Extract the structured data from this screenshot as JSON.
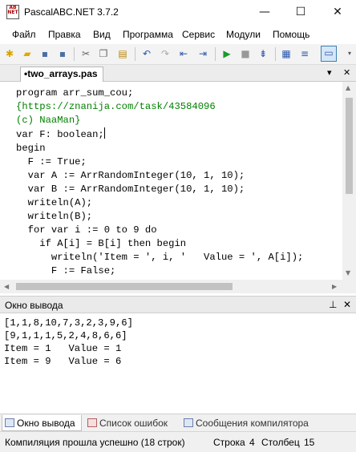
{
  "window": {
    "title": "PascalABC.NET 3.7.2",
    "minimize": "—",
    "maximize": "☐",
    "close": "✕"
  },
  "menu": [
    "Файл",
    "Правка",
    "Вид",
    "Программа",
    "Сервис",
    "Модули",
    "Помощь"
  ],
  "editor_tab": {
    "label": "•two_arrays.pas",
    "dropdown": "▾",
    "close": "✕"
  },
  "code": [
    "program arr_sum_cou;",
    "{https://znanija.com/task/43584096",
    "(c) NaaMan}",
    "var F: boolean;",
    "begin",
    "  F := True;",
    "  var A := ArrRandomInteger(10, 1, 10);",
    "  var B := ArrRandomInteger(10, 1, 10);",
    "  writeln(A);",
    "  writeln(B);",
    "  for var i := 0 to 9 do",
    "    if A[i] = B[i] then begin",
    "      writeln('Item = ', i, '   Value = ', A[i]);",
    "      F := False;"
  ],
  "output_panel": {
    "title": "Окно вывода",
    "pin": "⊥",
    "close": "✕"
  },
  "output_lines": [
    "[1,1,8,10,7,3,2,3,9,6]",
    "[9,1,1,1,5,2,4,8,6,6]",
    "Item = 1   Value = 1",
    "Item = 9   Value = 6"
  ],
  "bottom_tabs": [
    "Окно вывода",
    "Список ошибок",
    "Сообщения компилятора"
  ],
  "status": {
    "message": "Компиляция прошла успешно (18 строк)",
    "row_label": "Строка",
    "row": "4",
    "col_label": "Столбец",
    "col": "15"
  }
}
